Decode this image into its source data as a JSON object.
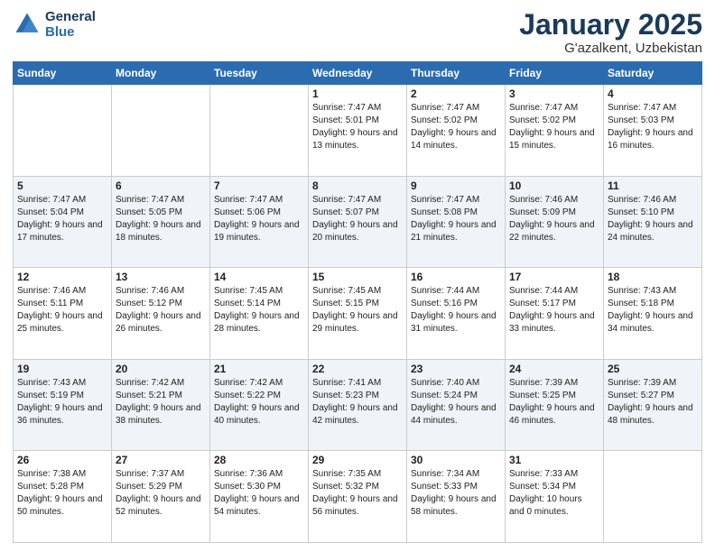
{
  "header": {
    "logo_line1": "General",
    "logo_line2": "Blue",
    "title": "January 2025",
    "subtitle": "G'azalkent, Uzbekistan"
  },
  "weekdays": [
    "Sunday",
    "Monday",
    "Tuesday",
    "Wednesday",
    "Thursday",
    "Friday",
    "Saturday"
  ],
  "weeks": [
    [
      {
        "day": "",
        "info": ""
      },
      {
        "day": "",
        "info": ""
      },
      {
        "day": "",
        "info": ""
      },
      {
        "day": "1",
        "info": "Sunrise: 7:47 AM\nSunset: 5:01 PM\nDaylight: 9 hours and 13 minutes."
      },
      {
        "day": "2",
        "info": "Sunrise: 7:47 AM\nSunset: 5:02 PM\nDaylight: 9 hours and 14 minutes."
      },
      {
        "day": "3",
        "info": "Sunrise: 7:47 AM\nSunset: 5:02 PM\nDaylight: 9 hours and 15 minutes."
      },
      {
        "day": "4",
        "info": "Sunrise: 7:47 AM\nSunset: 5:03 PM\nDaylight: 9 hours and 16 minutes."
      }
    ],
    [
      {
        "day": "5",
        "info": "Sunrise: 7:47 AM\nSunset: 5:04 PM\nDaylight: 9 hours and 17 minutes."
      },
      {
        "day": "6",
        "info": "Sunrise: 7:47 AM\nSunset: 5:05 PM\nDaylight: 9 hours and 18 minutes."
      },
      {
        "day": "7",
        "info": "Sunrise: 7:47 AM\nSunset: 5:06 PM\nDaylight: 9 hours and 19 minutes."
      },
      {
        "day": "8",
        "info": "Sunrise: 7:47 AM\nSunset: 5:07 PM\nDaylight: 9 hours and 20 minutes."
      },
      {
        "day": "9",
        "info": "Sunrise: 7:47 AM\nSunset: 5:08 PM\nDaylight: 9 hours and 21 minutes."
      },
      {
        "day": "10",
        "info": "Sunrise: 7:46 AM\nSunset: 5:09 PM\nDaylight: 9 hours and 22 minutes."
      },
      {
        "day": "11",
        "info": "Sunrise: 7:46 AM\nSunset: 5:10 PM\nDaylight: 9 hours and 24 minutes."
      }
    ],
    [
      {
        "day": "12",
        "info": "Sunrise: 7:46 AM\nSunset: 5:11 PM\nDaylight: 9 hours and 25 minutes."
      },
      {
        "day": "13",
        "info": "Sunrise: 7:46 AM\nSunset: 5:12 PM\nDaylight: 9 hours and 26 minutes."
      },
      {
        "day": "14",
        "info": "Sunrise: 7:45 AM\nSunset: 5:14 PM\nDaylight: 9 hours and 28 minutes."
      },
      {
        "day": "15",
        "info": "Sunrise: 7:45 AM\nSunset: 5:15 PM\nDaylight: 9 hours and 29 minutes."
      },
      {
        "day": "16",
        "info": "Sunrise: 7:44 AM\nSunset: 5:16 PM\nDaylight: 9 hours and 31 minutes."
      },
      {
        "day": "17",
        "info": "Sunrise: 7:44 AM\nSunset: 5:17 PM\nDaylight: 9 hours and 33 minutes."
      },
      {
        "day": "18",
        "info": "Sunrise: 7:43 AM\nSunset: 5:18 PM\nDaylight: 9 hours and 34 minutes."
      }
    ],
    [
      {
        "day": "19",
        "info": "Sunrise: 7:43 AM\nSunset: 5:19 PM\nDaylight: 9 hours and 36 minutes."
      },
      {
        "day": "20",
        "info": "Sunrise: 7:42 AM\nSunset: 5:21 PM\nDaylight: 9 hours and 38 minutes."
      },
      {
        "day": "21",
        "info": "Sunrise: 7:42 AM\nSunset: 5:22 PM\nDaylight: 9 hours and 40 minutes."
      },
      {
        "day": "22",
        "info": "Sunrise: 7:41 AM\nSunset: 5:23 PM\nDaylight: 9 hours and 42 minutes."
      },
      {
        "day": "23",
        "info": "Sunrise: 7:40 AM\nSunset: 5:24 PM\nDaylight: 9 hours and 44 minutes."
      },
      {
        "day": "24",
        "info": "Sunrise: 7:39 AM\nSunset: 5:25 PM\nDaylight: 9 hours and 46 minutes."
      },
      {
        "day": "25",
        "info": "Sunrise: 7:39 AM\nSunset: 5:27 PM\nDaylight: 9 hours and 48 minutes."
      }
    ],
    [
      {
        "day": "26",
        "info": "Sunrise: 7:38 AM\nSunset: 5:28 PM\nDaylight: 9 hours and 50 minutes."
      },
      {
        "day": "27",
        "info": "Sunrise: 7:37 AM\nSunset: 5:29 PM\nDaylight: 9 hours and 52 minutes."
      },
      {
        "day": "28",
        "info": "Sunrise: 7:36 AM\nSunset: 5:30 PM\nDaylight: 9 hours and 54 minutes."
      },
      {
        "day": "29",
        "info": "Sunrise: 7:35 AM\nSunset: 5:32 PM\nDaylight: 9 hours and 56 minutes."
      },
      {
        "day": "30",
        "info": "Sunrise: 7:34 AM\nSunset: 5:33 PM\nDaylight: 9 hours and 58 minutes."
      },
      {
        "day": "31",
        "info": "Sunrise: 7:33 AM\nSunset: 5:34 PM\nDaylight: 10 hours and 0 minutes."
      },
      {
        "day": "",
        "info": ""
      }
    ]
  ]
}
